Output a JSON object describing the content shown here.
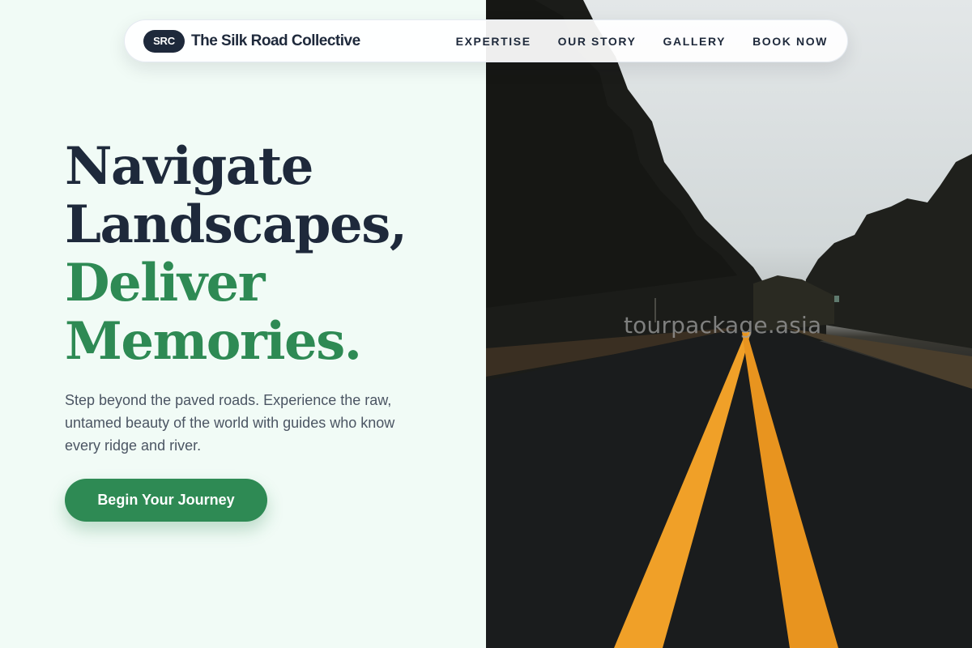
{
  "header": {
    "logo_badge": "SRC",
    "brand_name": "The Silk Road Collective",
    "nav": [
      {
        "label": "EXPERTISE"
      },
      {
        "label": "OUR STORY"
      },
      {
        "label": "GALLERY"
      },
      {
        "label": "BOOK NOW"
      }
    ]
  },
  "hero": {
    "headline_line1": "Navigate",
    "headline_line2": "Landscapes,",
    "headline_line3": "Deliver",
    "headline_line4": "Memories.",
    "description": "Step beyond the paved roads. Experience the raw, untamed beauty of the world with guides who know every ridge and river.",
    "cta_label": "Begin Your Journey"
  },
  "image": {
    "watermark": "tourpackage.asia"
  },
  "colors": {
    "primary_dark": "#1e293b",
    "accent_green": "#2e8a54",
    "background": "#f1fbf6",
    "road_line": "#f0a028"
  }
}
